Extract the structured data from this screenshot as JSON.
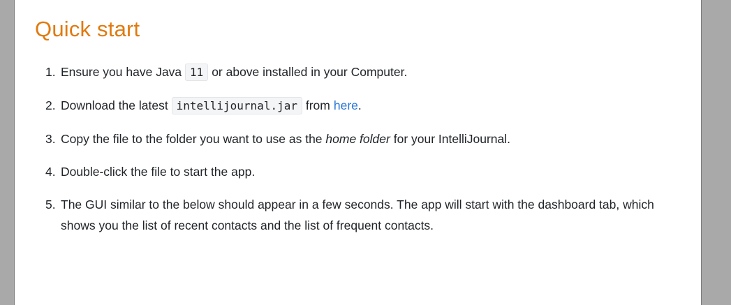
{
  "doc": {
    "heading": "Quick start",
    "steps": [
      {
        "num": "1.",
        "a": "Ensure you have Java",
        "code": "11",
        "b": "or above installed in your Computer."
      },
      {
        "num": "2.",
        "a": "Download the latest",
        "code": "intellijournal.jar",
        "b": "from",
        "link": "here",
        "c": "."
      },
      {
        "num": "3.",
        "a": "Copy the file to the folder you want to use as the",
        "em": "home folder",
        "b": "for your IntelliJournal."
      },
      {
        "num": "4.",
        "a": "Double-click the file to start the app."
      },
      {
        "num": "5.",
        "a": "The GUI similar to the below should appear in a few seconds. The app will start with the dashboard tab, which shows you the list of recent contacts and the list of frequent contacts."
      }
    ]
  },
  "colors": {
    "heading": "#e07a10",
    "link": "#2a78d6",
    "text": "#212529",
    "code_bg": "#f4f5f7",
    "side_gutter": "#a9a9a9"
  }
}
